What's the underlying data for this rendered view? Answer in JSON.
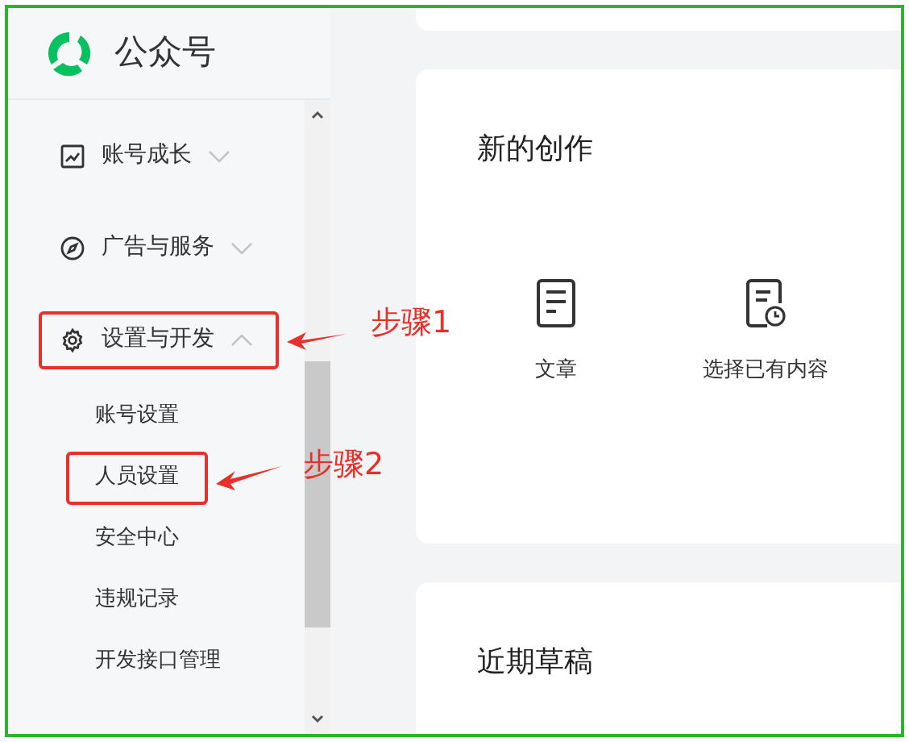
{
  "app": {
    "name": "公众号"
  },
  "sidebar": {
    "items": [
      {
        "kind": "chart",
        "label": "账号成长",
        "expanded": false,
        "highlighted": false
      },
      {
        "kind": "compass",
        "label": "广告与服务",
        "expanded": false,
        "highlighted": false
      },
      {
        "kind": "gear",
        "label": "设置与开发",
        "expanded": true,
        "highlighted": true,
        "annotation": "步骤1",
        "children": [
          {
            "label": "账号设置",
            "highlighted": false
          },
          {
            "label": "人员设置",
            "highlighted": true,
            "annotation": "步骤2"
          },
          {
            "label": "安全中心",
            "highlighted": false
          },
          {
            "label": "违规记录",
            "highlighted": false
          },
          {
            "label": "开发接口管理",
            "highlighted": false
          }
        ]
      }
    ]
  },
  "cards": [
    {
      "title": "新的创作",
      "actions": [
        {
          "kind": "article",
          "label": "文章"
        },
        {
          "kind": "existing",
          "label": "选择已有内容"
        }
      ]
    },
    {
      "title": "近期草稿"
    }
  ]
}
